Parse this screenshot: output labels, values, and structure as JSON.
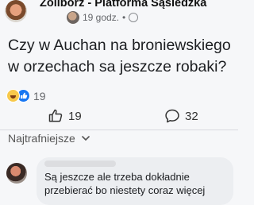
{
  "post": {
    "group_name": "Żoliborz - Platforma Sąsiedzka",
    "time": "19 godz.",
    "separator": "•",
    "text": "Czy w Auchan na broniewskiego w orzechach sa jeszcze robaki?"
  },
  "reactions": {
    "count": "19",
    "types": [
      "haha",
      "like"
    ]
  },
  "actions": {
    "likes": "19",
    "comments": "32"
  },
  "comments": {
    "sort_label": "Najtrafniejsze",
    "first_comment_text": "Są jeszcze ale trzeba dokładnie przebierać bo niestety coraz więcej"
  },
  "colors": {
    "accent": "#1877f2",
    "meta_text": "#65676b",
    "bubble": "#eceef1"
  }
}
